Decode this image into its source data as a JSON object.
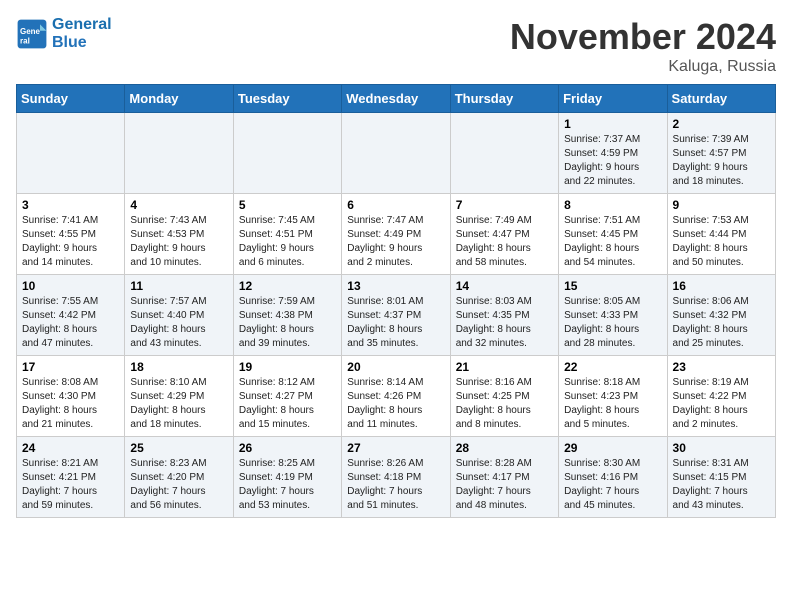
{
  "logo": {
    "line1": "General",
    "line2": "Blue"
  },
  "title": "November 2024",
  "subtitle": "Kaluga, Russia",
  "weekdays": [
    "Sunday",
    "Monday",
    "Tuesday",
    "Wednesday",
    "Thursday",
    "Friday",
    "Saturday"
  ],
  "weeks": [
    [
      {
        "day": "",
        "info": ""
      },
      {
        "day": "",
        "info": ""
      },
      {
        "day": "",
        "info": ""
      },
      {
        "day": "",
        "info": ""
      },
      {
        "day": "",
        "info": ""
      },
      {
        "day": "1",
        "info": "Sunrise: 7:37 AM\nSunset: 4:59 PM\nDaylight: 9 hours\nand 22 minutes."
      },
      {
        "day": "2",
        "info": "Sunrise: 7:39 AM\nSunset: 4:57 PM\nDaylight: 9 hours\nand 18 minutes."
      }
    ],
    [
      {
        "day": "3",
        "info": "Sunrise: 7:41 AM\nSunset: 4:55 PM\nDaylight: 9 hours\nand 14 minutes."
      },
      {
        "day": "4",
        "info": "Sunrise: 7:43 AM\nSunset: 4:53 PM\nDaylight: 9 hours\nand 10 minutes."
      },
      {
        "day": "5",
        "info": "Sunrise: 7:45 AM\nSunset: 4:51 PM\nDaylight: 9 hours\nand 6 minutes."
      },
      {
        "day": "6",
        "info": "Sunrise: 7:47 AM\nSunset: 4:49 PM\nDaylight: 9 hours\nand 2 minutes."
      },
      {
        "day": "7",
        "info": "Sunrise: 7:49 AM\nSunset: 4:47 PM\nDaylight: 8 hours\nand 58 minutes."
      },
      {
        "day": "8",
        "info": "Sunrise: 7:51 AM\nSunset: 4:45 PM\nDaylight: 8 hours\nand 54 minutes."
      },
      {
        "day": "9",
        "info": "Sunrise: 7:53 AM\nSunset: 4:44 PM\nDaylight: 8 hours\nand 50 minutes."
      }
    ],
    [
      {
        "day": "10",
        "info": "Sunrise: 7:55 AM\nSunset: 4:42 PM\nDaylight: 8 hours\nand 47 minutes."
      },
      {
        "day": "11",
        "info": "Sunrise: 7:57 AM\nSunset: 4:40 PM\nDaylight: 8 hours\nand 43 minutes."
      },
      {
        "day": "12",
        "info": "Sunrise: 7:59 AM\nSunset: 4:38 PM\nDaylight: 8 hours\nand 39 minutes."
      },
      {
        "day": "13",
        "info": "Sunrise: 8:01 AM\nSunset: 4:37 PM\nDaylight: 8 hours\nand 35 minutes."
      },
      {
        "day": "14",
        "info": "Sunrise: 8:03 AM\nSunset: 4:35 PM\nDaylight: 8 hours\nand 32 minutes."
      },
      {
        "day": "15",
        "info": "Sunrise: 8:05 AM\nSunset: 4:33 PM\nDaylight: 8 hours\nand 28 minutes."
      },
      {
        "day": "16",
        "info": "Sunrise: 8:06 AM\nSunset: 4:32 PM\nDaylight: 8 hours\nand 25 minutes."
      }
    ],
    [
      {
        "day": "17",
        "info": "Sunrise: 8:08 AM\nSunset: 4:30 PM\nDaylight: 8 hours\nand 21 minutes."
      },
      {
        "day": "18",
        "info": "Sunrise: 8:10 AM\nSunset: 4:29 PM\nDaylight: 8 hours\nand 18 minutes."
      },
      {
        "day": "19",
        "info": "Sunrise: 8:12 AM\nSunset: 4:27 PM\nDaylight: 8 hours\nand 15 minutes."
      },
      {
        "day": "20",
        "info": "Sunrise: 8:14 AM\nSunset: 4:26 PM\nDaylight: 8 hours\nand 11 minutes."
      },
      {
        "day": "21",
        "info": "Sunrise: 8:16 AM\nSunset: 4:25 PM\nDaylight: 8 hours\nand 8 minutes."
      },
      {
        "day": "22",
        "info": "Sunrise: 8:18 AM\nSunset: 4:23 PM\nDaylight: 8 hours\nand 5 minutes."
      },
      {
        "day": "23",
        "info": "Sunrise: 8:19 AM\nSunset: 4:22 PM\nDaylight: 8 hours\nand 2 minutes."
      }
    ],
    [
      {
        "day": "24",
        "info": "Sunrise: 8:21 AM\nSunset: 4:21 PM\nDaylight: 7 hours\nand 59 minutes."
      },
      {
        "day": "25",
        "info": "Sunrise: 8:23 AM\nSunset: 4:20 PM\nDaylight: 7 hours\nand 56 minutes."
      },
      {
        "day": "26",
        "info": "Sunrise: 8:25 AM\nSunset: 4:19 PM\nDaylight: 7 hours\nand 53 minutes."
      },
      {
        "day": "27",
        "info": "Sunrise: 8:26 AM\nSunset: 4:18 PM\nDaylight: 7 hours\nand 51 minutes."
      },
      {
        "day": "28",
        "info": "Sunrise: 8:28 AM\nSunset: 4:17 PM\nDaylight: 7 hours\nand 48 minutes."
      },
      {
        "day": "29",
        "info": "Sunrise: 8:30 AM\nSunset: 4:16 PM\nDaylight: 7 hours\nand 45 minutes."
      },
      {
        "day": "30",
        "info": "Sunrise: 8:31 AM\nSunset: 4:15 PM\nDaylight: 7 hours\nand 43 minutes."
      }
    ]
  ]
}
